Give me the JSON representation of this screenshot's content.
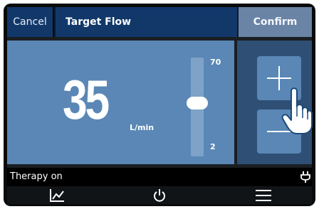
{
  "header": {
    "cancel_label": "Cancel",
    "title": "Target Flow",
    "confirm_label": "Confirm"
  },
  "flow": {
    "value": "35",
    "unit": "L/min",
    "max": "70",
    "min": "2",
    "level": 0.48
  },
  "controls": {
    "increment_icon": "plus-icon",
    "decrement_icon": "minus-icon"
  },
  "status": {
    "text": "Therapy on",
    "power_icon": "plug-icon"
  },
  "nav": [
    {
      "icon": "trend-chart-icon"
    },
    {
      "icon": "power-icon"
    },
    {
      "icon": "menu-icon"
    }
  ],
  "colors": {
    "header_blue": "#12386a",
    "confirm_gray_blue": "#6a84a6",
    "panel_blue": "#5a87b5",
    "side_panel": "#2f4f74"
  }
}
